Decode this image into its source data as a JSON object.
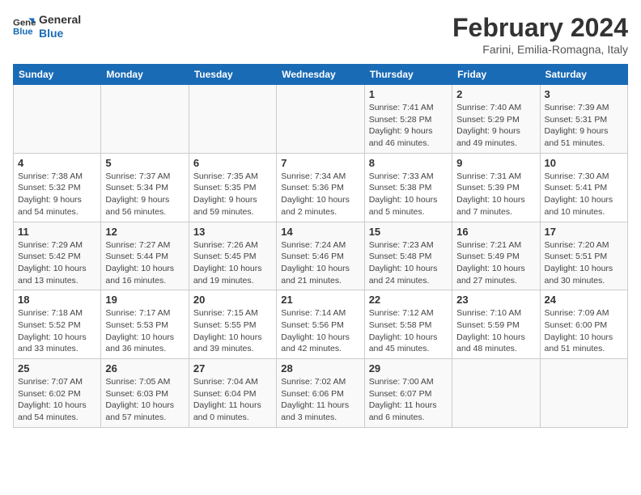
{
  "logo": {
    "line1": "General",
    "line2": "Blue"
  },
  "title": "February 2024",
  "subtitle": "Farini, Emilia-Romagna, Italy",
  "days_of_week": [
    "Sunday",
    "Monday",
    "Tuesday",
    "Wednesday",
    "Thursday",
    "Friday",
    "Saturday"
  ],
  "weeks": [
    [
      {
        "day": "",
        "info": ""
      },
      {
        "day": "",
        "info": ""
      },
      {
        "day": "",
        "info": ""
      },
      {
        "day": "",
        "info": ""
      },
      {
        "day": "1",
        "info": "Sunrise: 7:41 AM\nSunset: 5:28 PM\nDaylight: 9 hours\nand 46 minutes."
      },
      {
        "day": "2",
        "info": "Sunrise: 7:40 AM\nSunset: 5:29 PM\nDaylight: 9 hours\nand 49 minutes."
      },
      {
        "day": "3",
        "info": "Sunrise: 7:39 AM\nSunset: 5:31 PM\nDaylight: 9 hours\nand 51 minutes."
      }
    ],
    [
      {
        "day": "4",
        "info": "Sunrise: 7:38 AM\nSunset: 5:32 PM\nDaylight: 9 hours\nand 54 minutes."
      },
      {
        "day": "5",
        "info": "Sunrise: 7:37 AM\nSunset: 5:34 PM\nDaylight: 9 hours\nand 56 minutes."
      },
      {
        "day": "6",
        "info": "Sunrise: 7:35 AM\nSunset: 5:35 PM\nDaylight: 9 hours\nand 59 minutes."
      },
      {
        "day": "7",
        "info": "Sunrise: 7:34 AM\nSunset: 5:36 PM\nDaylight: 10 hours\nand 2 minutes."
      },
      {
        "day": "8",
        "info": "Sunrise: 7:33 AM\nSunset: 5:38 PM\nDaylight: 10 hours\nand 5 minutes."
      },
      {
        "day": "9",
        "info": "Sunrise: 7:31 AM\nSunset: 5:39 PM\nDaylight: 10 hours\nand 7 minutes."
      },
      {
        "day": "10",
        "info": "Sunrise: 7:30 AM\nSunset: 5:41 PM\nDaylight: 10 hours\nand 10 minutes."
      }
    ],
    [
      {
        "day": "11",
        "info": "Sunrise: 7:29 AM\nSunset: 5:42 PM\nDaylight: 10 hours\nand 13 minutes."
      },
      {
        "day": "12",
        "info": "Sunrise: 7:27 AM\nSunset: 5:44 PM\nDaylight: 10 hours\nand 16 minutes."
      },
      {
        "day": "13",
        "info": "Sunrise: 7:26 AM\nSunset: 5:45 PM\nDaylight: 10 hours\nand 19 minutes."
      },
      {
        "day": "14",
        "info": "Sunrise: 7:24 AM\nSunset: 5:46 PM\nDaylight: 10 hours\nand 21 minutes."
      },
      {
        "day": "15",
        "info": "Sunrise: 7:23 AM\nSunset: 5:48 PM\nDaylight: 10 hours\nand 24 minutes."
      },
      {
        "day": "16",
        "info": "Sunrise: 7:21 AM\nSunset: 5:49 PM\nDaylight: 10 hours\nand 27 minutes."
      },
      {
        "day": "17",
        "info": "Sunrise: 7:20 AM\nSunset: 5:51 PM\nDaylight: 10 hours\nand 30 minutes."
      }
    ],
    [
      {
        "day": "18",
        "info": "Sunrise: 7:18 AM\nSunset: 5:52 PM\nDaylight: 10 hours\nand 33 minutes."
      },
      {
        "day": "19",
        "info": "Sunrise: 7:17 AM\nSunset: 5:53 PM\nDaylight: 10 hours\nand 36 minutes."
      },
      {
        "day": "20",
        "info": "Sunrise: 7:15 AM\nSunset: 5:55 PM\nDaylight: 10 hours\nand 39 minutes."
      },
      {
        "day": "21",
        "info": "Sunrise: 7:14 AM\nSunset: 5:56 PM\nDaylight: 10 hours\nand 42 minutes."
      },
      {
        "day": "22",
        "info": "Sunrise: 7:12 AM\nSunset: 5:58 PM\nDaylight: 10 hours\nand 45 minutes."
      },
      {
        "day": "23",
        "info": "Sunrise: 7:10 AM\nSunset: 5:59 PM\nDaylight: 10 hours\nand 48 minutes."
      },
      {
        "day": "24",
        "info": "Sunrise: 7:09 AM\nSunset: 6:00 PM\nDaylight: 10 hours\nand 51 minutes."
      }
    ],
    [
      {
        "day": "25",
        "info": "Sunrise: 7:07 AM\nSunset: 6:02 PM\nDaylight: 10 hours\nand 54 minutes."
      },
      {
        "day": "26",
        "info": "Sunrise: 7:05 AM\nSunset: 6:03 PM\nDaylight: 10 hours\nand 57 minutes."
      },
      {
        "day": "27",
        "info": "Sunrise: 7:04 AM\nSunset: 6:04 PM\nDaylight: 11 hours\nand 0 minutes."
      },
      {
        "day": "28",
        "info": "Sunrise: 7:02 AM\nSunset: 6:06 PM\nDaylight: 11 hours\nand 3 minutes."
      },
      {
        "day": "29",
        "info": "Sunrise: 7:00 AM\nSunset: 6:07 PM\nDaylight: 11 hours\nand 6 minutes."
      },
      {
        "day": "",
        "info": ""
      },
      {
        "day": "",
        "info": ""
      }
    ]
  ]
}
